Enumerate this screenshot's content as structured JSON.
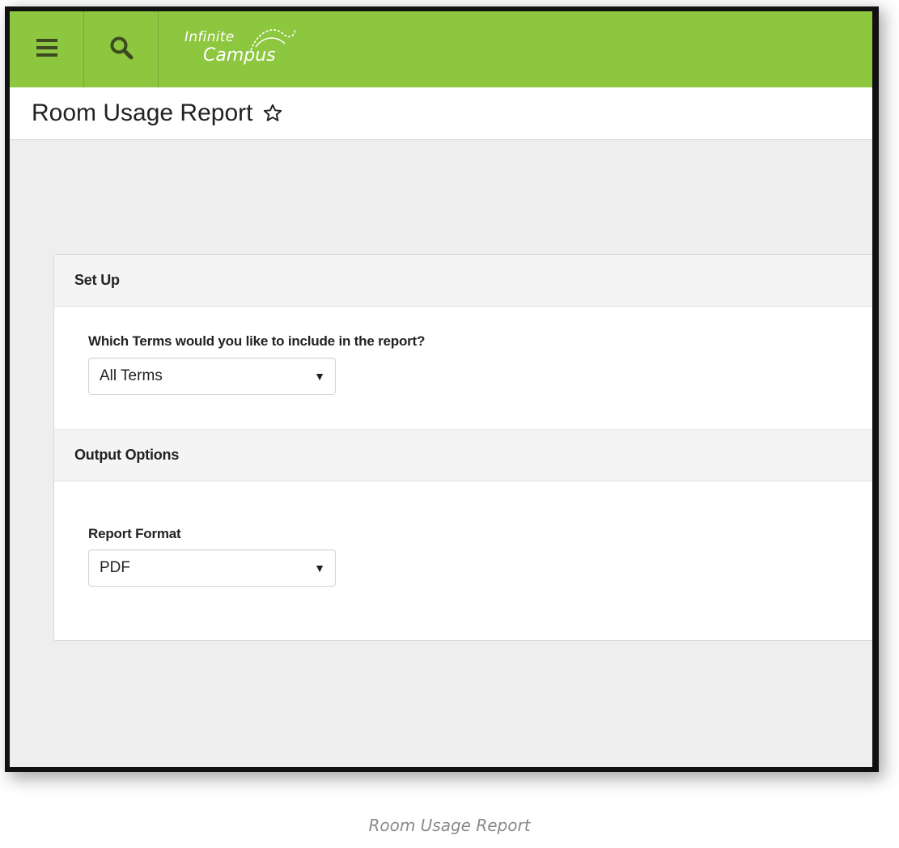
{
  "header": {
    "logo_line1": "Infinite",
    "logo_line2": "Campus",
    "menu_icon": "hamburger-menu-icon",
    "search_icon": "search-icon",
    "bar_color": "#8dc63f"
  },
  "page": {
    "title": "Room Usage Report",
    "favorite_icon": "star-outline-icon"
  },
  "setup": {
    "heading": "Set Up",
    "terms_label": "Which Terms would you like to include in the report?",
    "terms_value": "All Terms"
  },
  "output": {
    "heading": "Output Options",
    "format_label": "Report Format",
    "format_value": "PDF"
  },
  "caption": "Room Usage Report"
}
